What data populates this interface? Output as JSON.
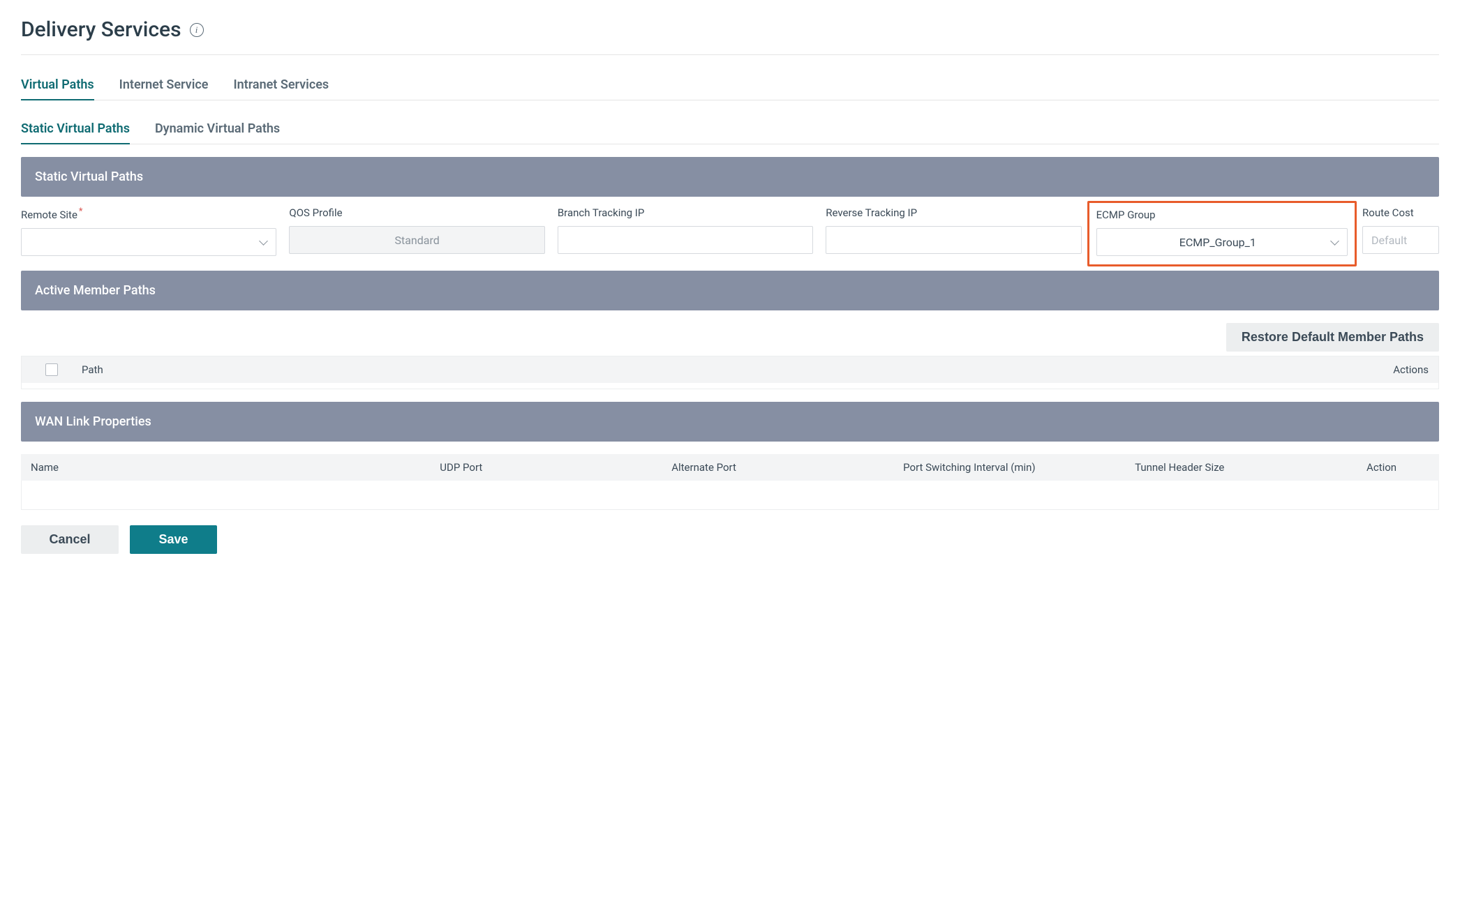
{
  "header": {
    "title": "Delivery Services",
    "info_tooltip": "i"
  },
  "tabs": {
    "items": [
      {
        "label": "Virtual Paths",
        "active": true
      },
      {
        "label": "Internet Service",
        "active": false
      },
      {
        "label": "Intranet Services",
        "active": false
      }
    ]
  },
  "subtabs": {
    "items": [
      {
        "label": "Static Virtual Paths",
        "active": true
      },
      {
        "label": "Dynamic Virtual Paths",
        "active": false
      }
    ]
  },
  "svp": {
    "header": "Static Virtual Paths",
    "fields": {
      "remote_site": {
        "label": "Remote Site",
        "required": true,
        "value": ""
      },
      "qos_profile": {
        "label": "QOS Profile",
        "value": "Standard",
        "disabled": true
      },
      "branch_tracking_ip": {
        "label": "Branch Tracking IP",
        "value": ""
      },
      "reverse_tracking_ip": {
        "label": "Reverse Tracking IP",
        "value": ""
      },
      "ecmp_group": {
        "label": "ECMP Group",
        "value": "ECMP_Group_1",
        "highlighted": true
      },
      "route_cost": {
        "label": "Route Cost",
        "placeholder": "Default"
      }
    }
  },
  "amp": {
    "header": "Active Member Paths",
    "restore_button": "Restore Default Member Paths",
    "columns": {
      "path": "Path",
      "actions": "Actions"
    }
  },
  "wlp": {
    "header": "WAN Link Properties",
    "columns": {
      "name": "Name",
      "udp_port": "UDP Port",
      "alternate_port": "Alternate Port",
      "port_switch_interval": "Port Switching Interval (min)",
      "tunnel_header_size": "Tunnel Header Size",
      "action": "Action"
    }
  },
  "actions": {
    "cancel": "Cancel",
    "save": "Save"
  }
}
